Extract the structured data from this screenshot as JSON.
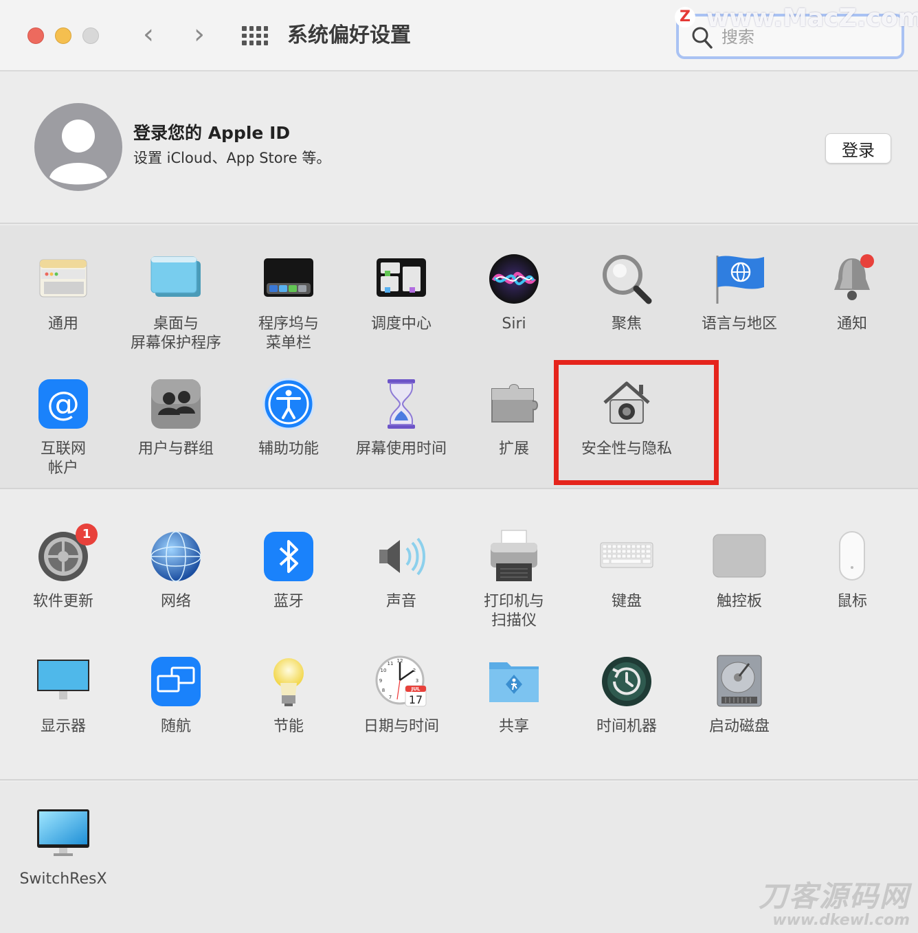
{
  "window": {
    "title": "系统偏好设置",
    "search_placeholder": "搜索"
  },
  "apple_id": {
    "title": "登录您的 Apple ID",
    "subtitle": "设置 iCloud、App Store 等。",
    "login_label": "登录"
  },
  "row1": [
    {
      "label": "通用",
      "icon": "general-icon"
    },
    {
      "label": "桌面与\n屏幕保护程序",
      "icon": "desktop-screensaver-icon"
    },
    {
      "label": "程序坞与\n菜单栏",
      "icon": "dock-menubar-icon"
    },
    {
      "label": "调度中心",
      "icon": "mission-control-icon"
    },
    {
      "label": "Siri",
      "icon": "siri-icon"
    },
    {
      "label": "聚焦",
      "icon": "spotlight-icon"
    },
    {
      "label": "语言与地区",
      "icon": "language-region-icon"
    },
    {
      "label": "通知",
      "icon": "notifications-icon"
    }
  ],
  "row2": [
    {
      "label": "互联网\n帐户",
      "icon": "internet-accounts-icon"
    },
    {
      "label": "用户与群组",
      "icon": "users-groups-icon"
    },
    {
      "label": "辅助功能",
      "icon": "accessibility-icon"
    },
    {
      "label": "屏幕使用时间",
      "icon": "screen-time-icon"
    },
    {
      "label": "扩展",
      "icon": "extensions-icon"
    },
    {
      "label": "安全性与隐私",
      "icon": "security-privacy-icon"
    }
  ],
  "row3": [
    {
      "label": "软件更新",
      "icon": "software-update-icon",
      "badge": "1"
    },
    {
      "label": "网络",
      "icon": "network-icon"
    },
    {
      "label": "蓝牙",
      "icon": "bluetooth-icon"
    },
    {
      "label": "声音",
      "icon": "sound-icon"
    },
    {
      "label": "打印机与\n扫描仪",
      "icon": "printers-scanners-icon"
    },
    {
      "label": "键盘",
      "icon": "keyboard-icon"
    },
    {
      "label": "触控板",
      "icon": "trackpad-icon"
    },
    {
      "label": "鼠标",
      "icon": "mouse-icon"
    }
  ],
  "row4": [
    {
      "label": "显示器",
      "icon": "displays-icon"
    },
    {
      "label": "随航",
      "icon": "sidecar-icon"
    },
    {
      "label": "节能",
      "icon": "energy-saver-icon"
    },
    {
      "label": "日期与时间",
      "icon": "date-time-icon",
      "calendar_month": "JUL",
      "calendar_day": "17"
    },
    {
      "label": "共享",
      "icon": "sharing-icon"
    },
    {
      "label": "时间机器",
      "icon": "time-machine-icon"
    },
    {
      "label": "启动磁盘",
      "icon": "startup-disk-icon"
    }
  ],
  "row5": [
    {
      "label": "SwitchResX",
      "icon": "switchresx-icon"
    }
  ],
  "watermarks": {
    "top": "www.MacZ.com",
    "top_logo": "Z",
    "bottom_main": "刀客源码网",
    "bottom_url": "www.dkewl.com"
  },
  "colors": {
    "highlight": "#e5241c",
    "accent": "#1a82fb",
    "badge": "#e8413b"
  }
}
